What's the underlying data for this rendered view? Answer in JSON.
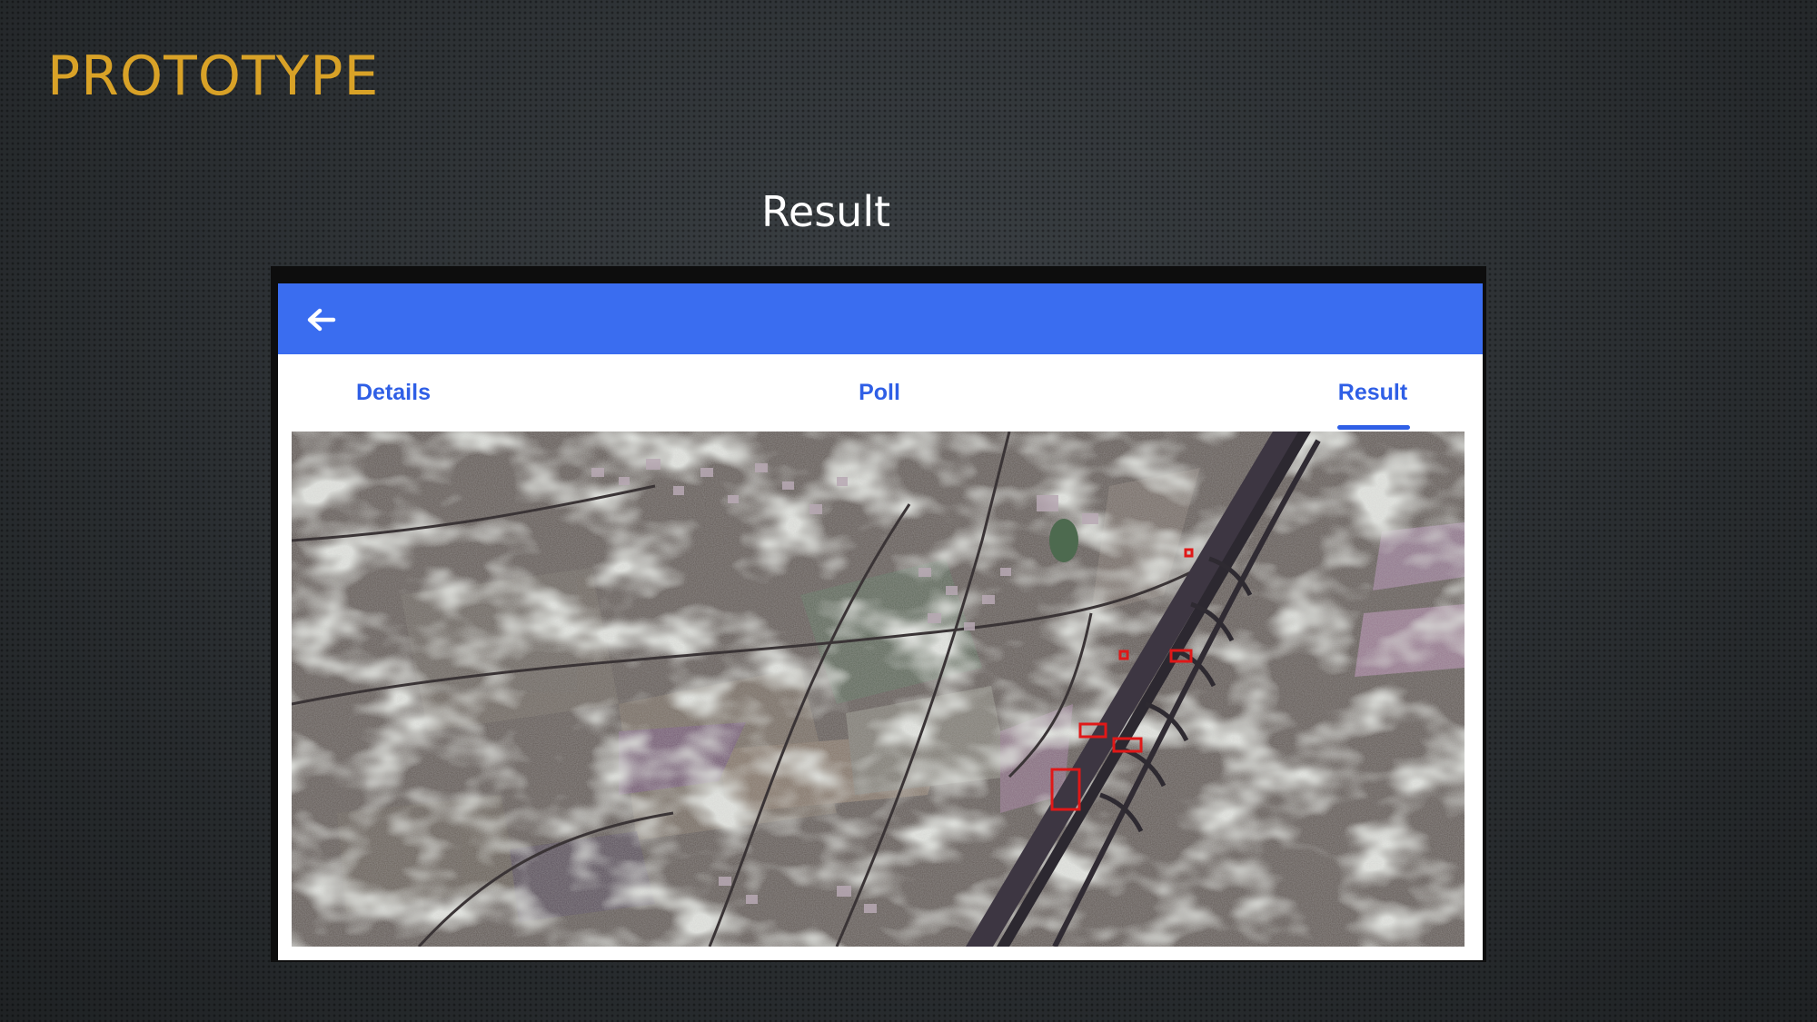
{
  "slide": {
    "title": "PROTOTYPE",
    "subtitle": "Result"
  },
  "colors": {
    "title_accent": "#d9a227",
    "app_bar": "#3a6df0",
    "tab_text": "#2f5fe6",
    "detection_box": "#e01818"
  },
  "app": {
    "back_icon": "arrow-left-icon",
    "tabs": [
      {
        "label": "Details",
        "active": false
      },
      {
        "label": "Poll",
        "active": false
      },
      {
        "label": "Result",
        "active": true
      }
    ],
    "result_image": {
      "icon": "aerial-image",
      "detection_count": 6
    }
  }
}
